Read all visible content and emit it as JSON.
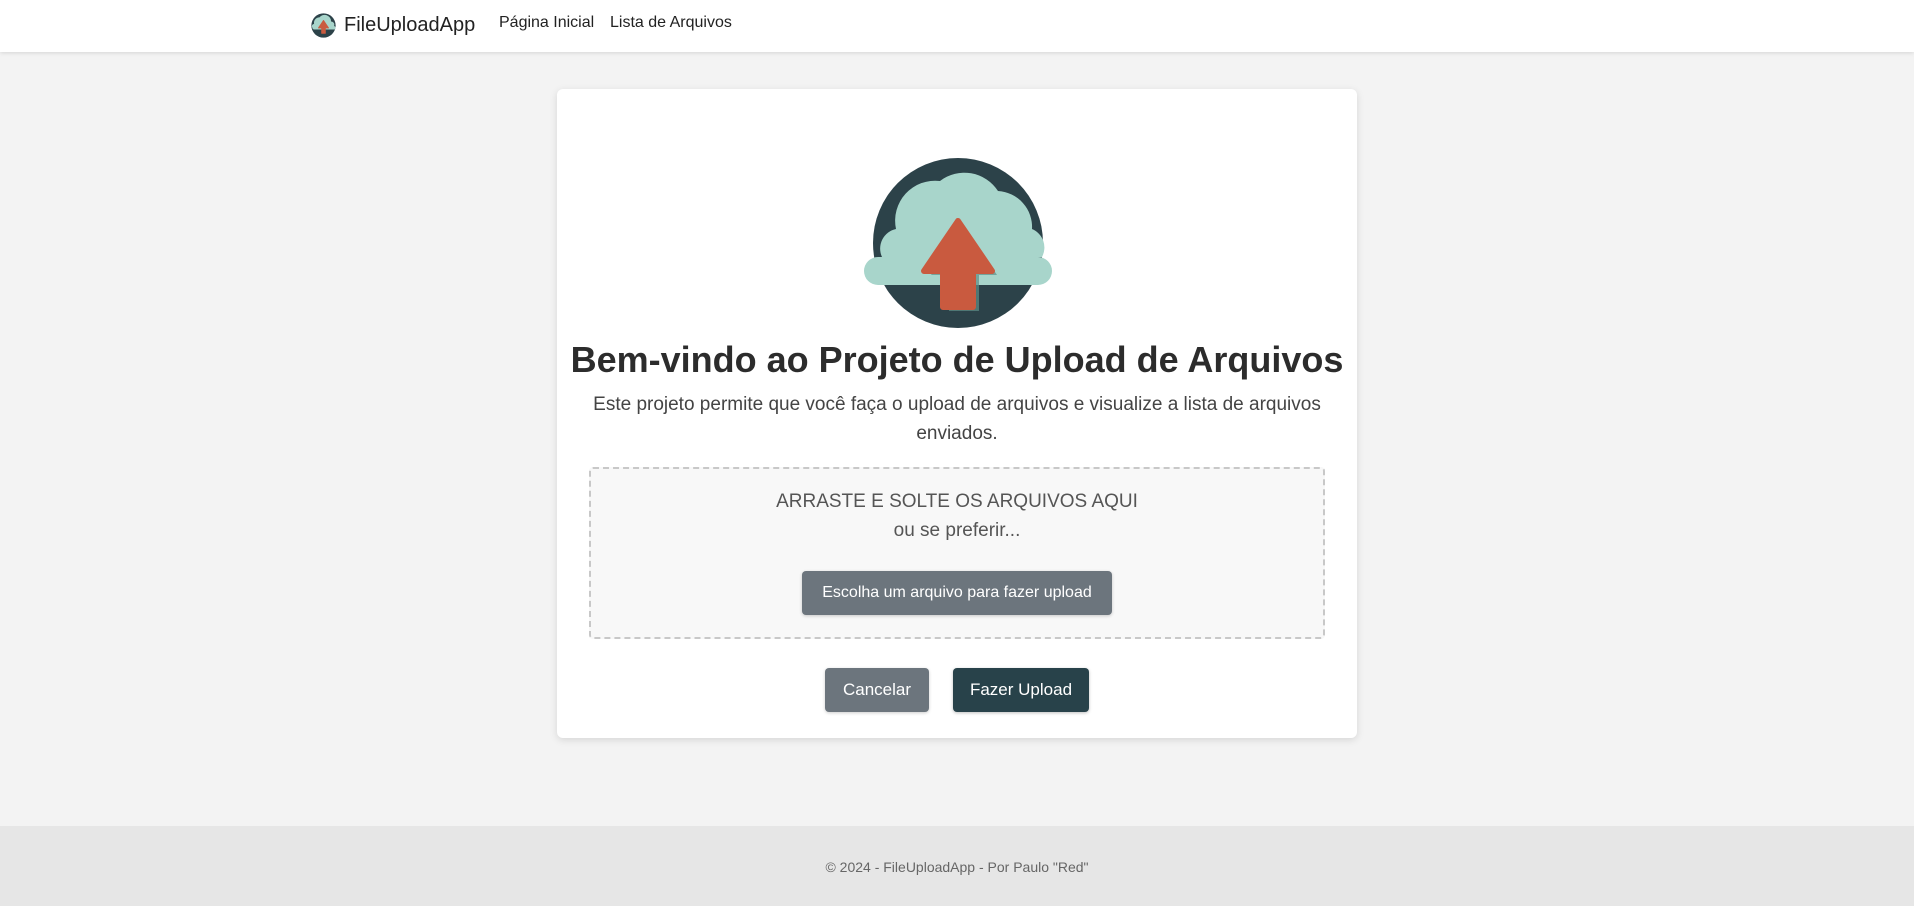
{
  "navbar": {
    "brand": "FileUploadApp",
    "logo_icon": "cloud-upload-icon",
    "links": [
      "Página Inicial",
      "Lista de Arquivos"
    ]
  },
  "hero": {
    "icon": "cloud-upload-icon",
    "title": "Bem-vindo ao Projeto de Upload de Arquivos",
    "subtitle": "Este projeto permite que você faça o upload de arquivos e visualize a lista de arquivos enviados."
  },
  "dropzone": {
    "title": "ARRASTE E SOLTE OS ARQUIVOS AQUI",
    "or_text": "ou se preferir...",
    "choose_button": "Escolha um arquivo para fazer upload"
  },
  "actions": {
    "cancel": "Cancelar",
    "upload": "Fazer Upload"
  },
  "footer": {
    "text": "© 2024 - FileUploadApp - Por Paulo \"Red\""
  },
  "colors": {
    "primary_dark": "#28424a",
    "secondary": "#6c757d",
    "cloud": "#a8d5cb",
    "arrow": "#c95a3f"
  }
}
